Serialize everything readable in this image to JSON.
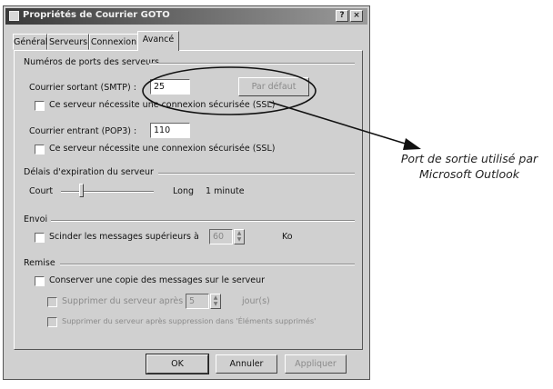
{
  "dialog": {
    "title": "Propriétés de Courrier GOTO",
    "help_button": "?",
    "close_button": "×"
  },
  "tabs": [
    {
      "label": "Général"
    },
    {
      "label": "Serveurs"
    },
    {
      "label": "Connexion"
    },
    {
      "label": "Avancé"
    }
  ],
  "ports": {
    "group_label": "Numéros de ports des serveurs",
    "smtp_label": "Courrier sortant (SMTP) :",
    "smtp_value": "25",
    "default_button": "Par défaut",
    "smtp_ssl_label": "Ce serveur nécessite une connexion sécurisée (SSL)",
    "pop3_label": "Courrier entrant (POP3) :",
    "pop3_value": "110",
    "pop3_ssl_label": "Ce serveur nécessite une connexion sécurisée (SSL)"
  },
  "timeout": {
    "group_label": "Délais d'expiration du serveur",
    "short_label": "Court",
    "long_label": "Long",
    "value_text": "1 minute"
  },
  "send": {
    "group_label": "Envoi",
    "split_label": "Scinder les messages supérieurs à",
    "split_value": "60",
    "unit": "Ko"
  },
  "delivery": {
    "group_label": "Remise",
    "keep_copy_label": "Conserver une copie des messages sur le serveur",
    "remove_after_label": "Supprimer du serveur après",
    "remove_after_value": "5",
    "days_label": "jour(s)",
    "remove_deleted_label": "Supprimer du serveur après suppression dans 'Éléments supprimés'"
  },
  "footer": {
    "ok": "OK",
    "cancel": "Annuler",
    "apply": "Appliquer"
  },
  "annotation": {
    "line1": "Port de sortie utilisé par",
    "line2": "Microsoft Outlook"
  }
}
